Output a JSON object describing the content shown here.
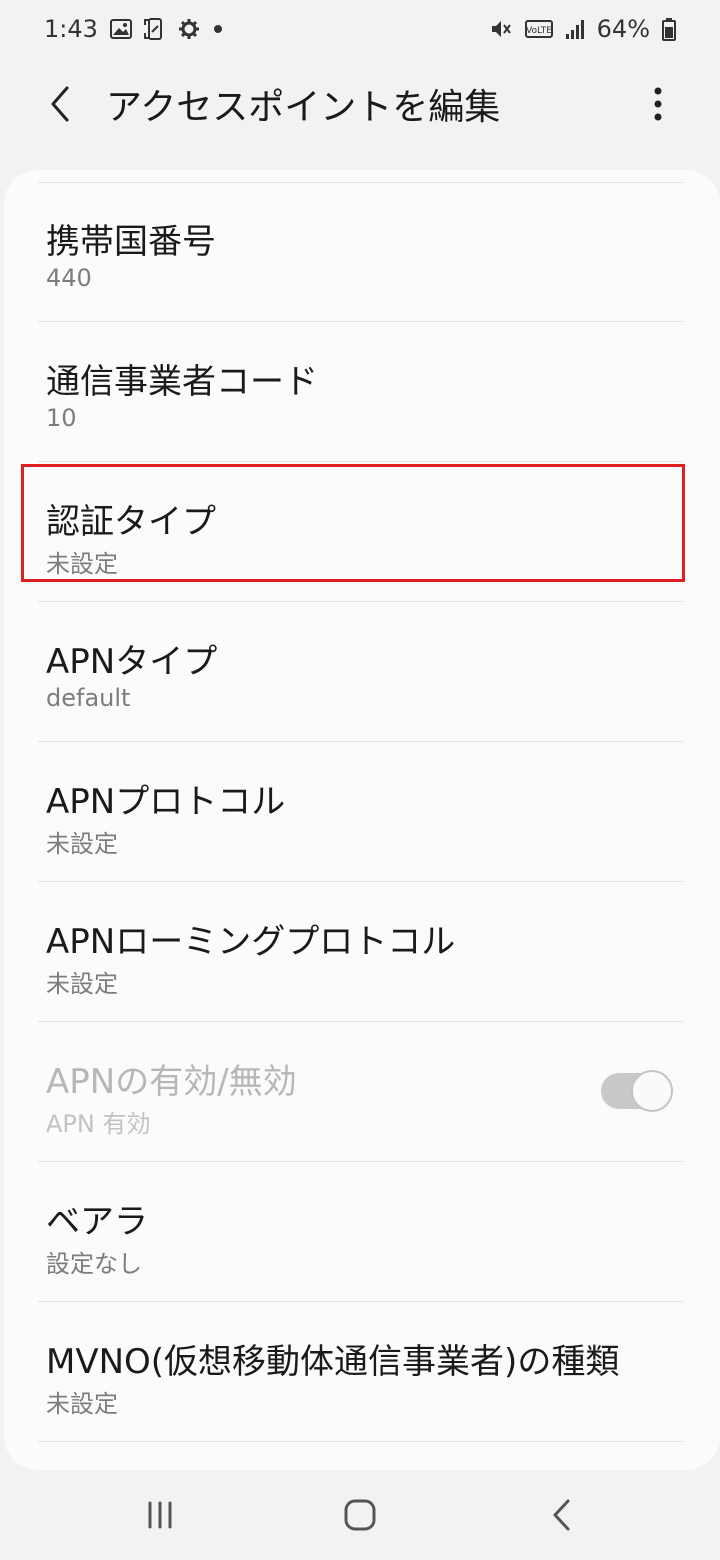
{
  "status_bar": {
    "time": "1:43",
    "battery_percent": "64%",
    "icons_left": [
      "image-icon",
      "screenshot-icon",
      "gear-icon",
      "dot-icon"
    ],
    "icons_right": [
      "mute-icon",
      "volte-icon",
      "signal-icon",
      "battery-icon"
    ],
    "volte_label": "VoLTE"
  },
  "app_bar": {
    "title": "アクセスポイントを編集"
  },
  "settings": [
    {
      "label": "携帯国番号",
      "value": "440"
    },
    {
      "label": "通信事業者コード",
      "value": "10"
    },
    {
      "label": "認証タイプ",
      "value": "未設定",
      "highlighted": true
    },
    {
      "label": "APNタイプ",
      "value": "default"
    },
    {
      "label": "APNプロトコル",
      "value": "未設定"
    },
    {
      "label": "APNローミングプロトコル",
      "value": "未設定"
    },
    {
      "label": "APNの有効/無効",
      "value": "APN 有効",
      "disabled": true,
      "toggle_on": true
    },
    {
      "label": "ベアラ",
      "value": "設定なし"
    },
    {
      "label": "MVNO(仮想移動体通信事業者)の種類",
      "value": "未設定"
    }
  ],
  "colors": {
    "highlight_border": "#e02020",
    "background": "#f2f2f2",
    "card": "#fbfbfb"
  },
  "nav_bar": {
    "icons": [
      "recent-apps-icon",
      "home-icon",
      "back-icon"
    ]
  }
}
